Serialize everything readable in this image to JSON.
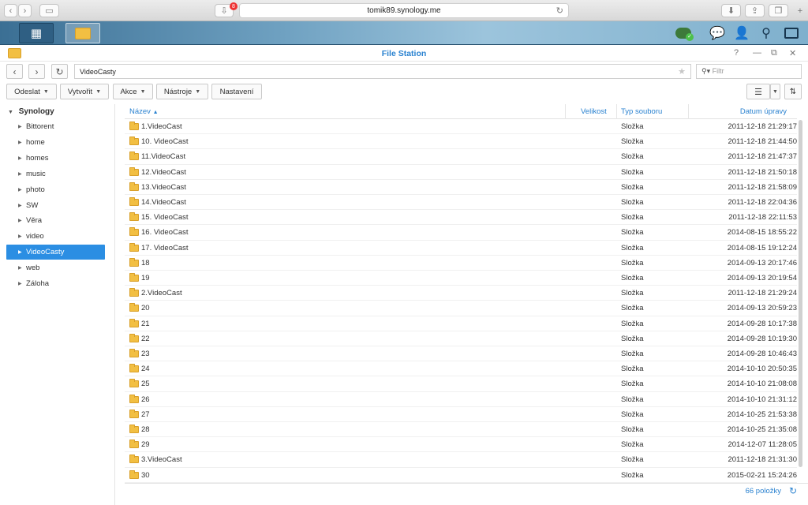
{
  "browser": {
    "url": "tomik89.synology.me",
    "downloads_badge": "8"
  },
  "window": {
    "title": "File Station"
  },
  "nav": {
    "path": "VideoCasty",
    "filter_placeholder": "Filtr"
  },
  "toolbar": {
    "upload": "Odeslat",
    "create": "Vytvořit",
    "action": "Akce",
    "tools": "Nástroje",
    "settings": "Nastavení"
  },
  "sidebar": {
    "root": "Synology",
    "items": [
      {
        "label": "Bittorent"
      },
      {
        "label": "home"
      },
      {
        "label": "homes"
      },
      {
        "label": "music"
      },
      {
        "label": "photo"
      },
      {
        "label": "SW"
      },
      {
        "label": "Věra"
      },
      {
        "label": "video"
      },
      {
        "label": "VideoCasty",
        "selected": true
      },
      {
        "label": "web"
      },
      {
        "label": "Záloha"
      }
    ]
  },
  "grid": {
    "columns": {
      "name": "Název",
      "size": "Velikost",
      "type": "Typ souboru",
      "date": "Datum úpravy"
    },
    "rows": [
      {
        "name": "1.VideoCast",
        "type": "Složka",
        "date": "2011-12-18 21:29:17"
      },
      {
        "name": "10. VideoCast",
        "type": "Složka",
        "date": "2011-12-18 21:44:50"
      },
      {
        "name": "11.VideoCast",
        "type": "Složka",
        "date": "2011-12-18 21:47:37"
      },
      {
        "name": "12.VideoCast",
        "type": "Složka",
        "date": "2011-12-18 21:50:18"
      },
      {
        "name": "13.VideoCast",
        "type": "Složka",
        "date": "2011-12-18 21:58:09"
      },
      {
        "name": "14.VideoCast",
        "type": "Složka",
        "date": "2011-12-18 22:04:36"
      },
      {
        "name": "15. VideoCast",
        "type": "Složka",
        "date": "2011-12-18 22:11:53"
      },
      {
        "name": "16. VideoCast",
        "type": "Složka",
        "date": "2014-08-15 18:55:22"
      },
      {
        "name": "17. VideoCast",
        "type": "Složka",
        "date": "2014-08-15 19:12:24"
      },
      {
        "name": "18",
        "type": "Složka",
        "date": "2014-09-13 20:17:46"
      },
      {
        "name": "19",
        "type": "Složka",
        "date": "2014-09-13 20:19:54"
      },
      {
        "name": "2.VideoCast",
        "type": "Složka",
        "date": "2011-12-18 21:29:24"
      },
      {
        "name": "20",
        "type": "Složka",
        "date": "2014-09-13 20:59:23"
      },
      {
        "name": "21",
        "type": "Složka",
        "date": "2014-09-28 10:17:38"
      },
      {
        "name": "22",
        "type": "Složka",
        "date": "2014-09-28 10:19:30"
      },
      {
        "name": "23",
        "type": "Složka",
        "date": "2014-09-28 10:46:43"
      },
      {
        "name": "24",
        "type": "Složka",
        "date": "2014-10-10 20:50:35"
      },
      {
        "name": "25",
        "type": "Složka",
        "date": "2014-10-10 21:08:08"
      },
      {
        "name": "26",
        "type": "Složka",
        "date": "2014-10-10 21:31:12"
      },
      {
        "name": "27",
        "type": "Složka",
        "date": "2014-10-25 21:53:38"
      },
      {
        "name": "28",
        "type": "Složka",
        "date": "2014-10-25 21:35:08"
      },
      {
        "name": "29",
        "type": "Složka",
        "date": "2014-12-07 11:28:05"
      },
      {
        "name": "3.VideoCast",
        "type": "Složka",
        "date": "2011-12-18 21:31:30"
      },
      {
        "name": "30",
        "type": "Složka",
        "date": "2015-02-21 15:24:26"
      }
    ]
  },
  "footer": {
    "count": "66 položky"
  },
  "colors": {
    "accent": "#2a82d0",
    "selected": "#2b8ee3",
    "folder": "#f2bf42"
  }
}
